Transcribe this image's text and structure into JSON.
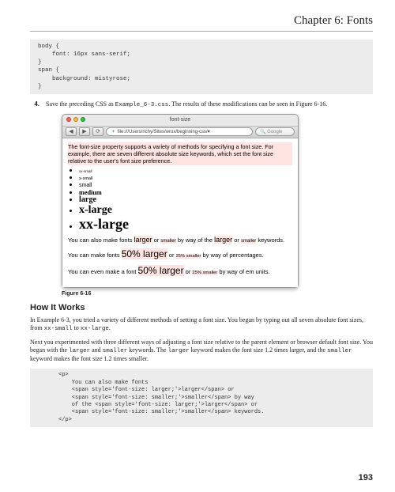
{
  "chapterTitle": "Chapter 6: Fonts",
  "code1": "body {\n    font: 16px sans-serif;\n}\nspan {\n    background: mistyrose;\n}",
  "step": {
    "num": "4.",
    "pre": "Save the preceding CSS as ",
    "file": "Example_6-3.css",
    "post": ". The results of these modifications can be seen in Figure 6-16."
  },
  "browser": {
    "title": "font-size",
    "nav": {
      "back": "◀",
      "fwd": "▶",
      "reload": "⟳"
    },
    "urlPlus": "+",
    "url": "file:///Users/richy/Sites/wrox/beginning-css/▾",
    "searchPlaceholder": "Google",
    "intro": "The font-size property supports a variety of methods for specifying a font size. For example, there are seven different absolute size keywords, which set the font size relative to the user's font size preference.",
    "sizes": [
      "xx-small",
      "x-small",
      "small",
      "medium",
      "large",
      "x-large",
      "xx-large"
    ],
    "p1": {
      "a": "You can also make fonts ",
      "larger": "larger",
      "b": " or ",
      "smaller": "smaller",
      "c": " by way of the ",
      "larger2": "larger",
      "d": " or ",
      "smaller2": "smaller",
      "e": " keywords."
    },
    "p2": {
      "a": "You can make fonts ",
      "big": "50% larger",
      "b": " or ",
      "small": "25% smaller",
      "c": " by way of percentages."
    },
    "p3": {
      "a": "You can even make a font ",
      "big": "50% larger",
      "b": " or ",
      "small": "25% smaller",
      "c": " by way of em units."
    }
  },
  "figCaption": "Figure 6-16",
  "h2": "How It Works",
  "para1": {
    "a": "In Example 6-3, you tried a variety of different methods of setting a font size. You began by typing out all seven absolute font sizes, from ",
    "c1": "xx-small",
    "b": " to ",
    "c2": "xx-large",
    "c": "."
  },
  "para2": {
    "a": "Next you experimented with three different ways of adjusting a font size relative to the parent element or browser default font size. You began with the ",
    "c1": "larger",
    "b": " and ",
    "c2": "smaller",
    "c": " keywords. The ",
    "c3": "larger",
    "d": " keyword makes the font size 1.2 times larger, and the ",
    "c4": "smaller",
    "e": " keyword makes the font size 1.2 times smaller."
  },
  "code2": "<p>\n    You can also make fonts\n    <span style='font-size: larger;'>larger</span> or\n    <span style='font-size: smaller;'>smaller</span> by way\n    of the <span style='font-size: larger;'>larger</span> or\n    <span style='font-size: smaller;'>smaller</span> keywords.\n</p>",
  "pageNum": "193"
}
